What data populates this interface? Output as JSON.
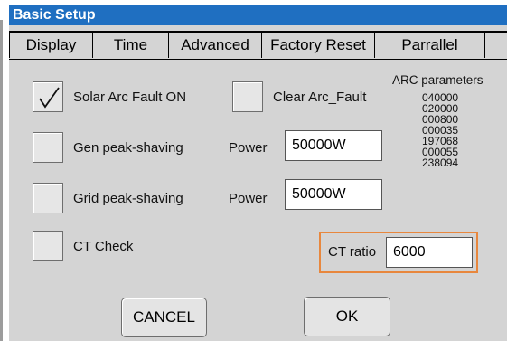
{
  "window": {
    "title": "Basic Setup"
  },
  "tabs": [
    {
      "label": "Display"
    },
    {
      "label": "Time"
    },
    {
      "label": "Advanced"
    },
    {
      "label": "Factory Reset"
    },
    {
      "label": "Parrallel"
    }
  ],
  "options": {
    "solar_arc_fault": {
      "label": "Solar Arc Fault ON",
      "checked": true
    },
    "clear_arc_fault": {
      "label": "Clear Arc_Fault",
      "checked": false
    },
    "gen_peak_shaving": {
      "label": "Gen peak-shaving",
      "checked": false,
      "power_label": "Power",
      "power_value": "50000W"
    },
    "grid_peak_shaving": {
      "label": "Grid peak-shaving",
      "checked": false,
      "power_label": "Power",
      "power_value": "50000W"
    },
    "ct_check": {
      "label": "CT Check",
      "checked": false
    }
  },
  "ct_ratio": {
    "label": "CT ratio",
    "value": "6000"
  },
  "arc_parameters": {
    "title": "ARC parameters",
    "values": [
      "040000",
      "020000",
      "000800",
      "000035",
      "197068",
      "000055",
      "238094"
    ]
  },
  "buttons": {
    "cancel": "CANCEL",
    "ok": "OK"
  },
  "colors": {
    "title_bar": "#1f6fc1",
    "panel": "#d4d4d4",
    "highlight_border": "#e8873d"
  }
}
